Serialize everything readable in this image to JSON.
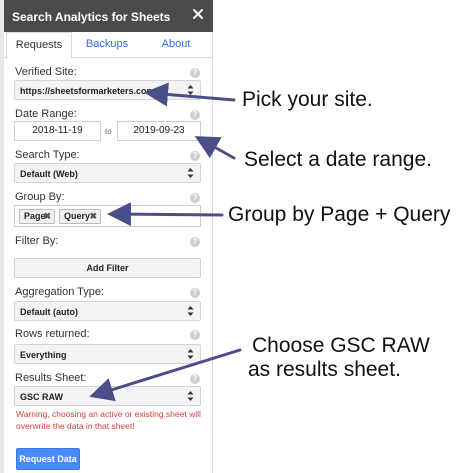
{
  "sidebar": {
    "title": "Search Analytics for Sheets",
    "tabs": [
      {
        "label": "Requests"
      },
      {
        "label": "Backups"
      },
      {
        "label": "About"
      }
    ],
    "verified_site": {
      "label": "Verified Site:",
      "value": "https://sheetsformarketers.com/"
    },
    "date_range": {
      "label": "Date Range:",
      "start": "2018-11-19",
      "to": "to",
      "end": "2019-09-23"
    },
    "search_type": {
      "label": "Search Type:",
      "value": "Default (Web)"
    },
    "group_by": {
      "label": "Group By:",
      "tags": [
        "Page",
        "Query"
      ]
    },
    "filter_by": {
      "label": "Filter By:",
      "button": "Add Filter"
    },
    "aggregation_type": {
      "label": "Aggregation Type:",
      "value": "Default (auto)"
    },
    "rows_returned": {
      "label": "Rows returned:",
      "value": "Everything"
    },
    "results_sheet": {
      "label": "Results Sheet:",
      "value": "GSC RAW"
    },
    "warning": "Warning, choosing an active or existing sheet will overwrite the data in that sheet!",
    "request_button": "Request Data"
  },
  "annotations": {
    "site": "Pick your site.",
    "date": "Select a date range.",
    "group": "Group by Page + Query",
    "gsc_line1": "Choose GSC RAW",
    "gsc_line2": "as results sheet."
  },
  "colors": {
    "titlebar": "#4a4a4a",
    "link": "#2a6fdb",
    "warning": "#d04040",
    "primary_button": "#4a8af4",
    "arrow": "#4b4f87"
  }
}
